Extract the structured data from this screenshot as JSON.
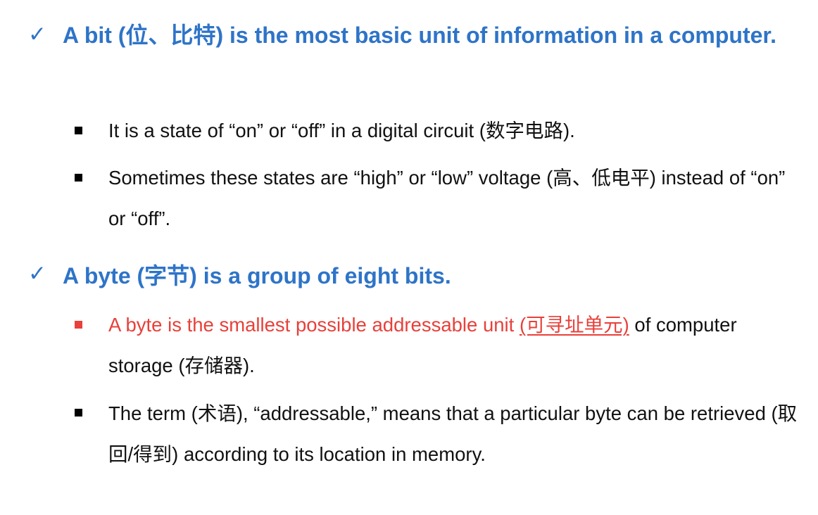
{
  "bullets": [
    {
      "heading": "A bit (位、比特) is the most basic unit of information in a computer.",
      "sub": [
        "It is a state of “on” or “off” in a digital circuit (数字电路).",
        "Sometimes these states are “high” or “low” voltage (高、低电平) instead of “on” or “off”."
      ]
    },
    {
      "heading": "A byte (字节) is a group of eight bits.",
      "sub": [
        {
          "red": "A byte is the smallest possible addressable unit ",
          "red_underlined": "(可寻址单元)",
          "rest": " of computer storage (存储器)."
        },
        "The term (术语), “addressable,” means that a particular byte can be retrieved (取回/得到) according to its location in memory."
      ]
    }
  ],
  "icons": {
    "check": "✓",
    "square": "square-bullet-icon"
  },
  "colors": {
    "heading": "#2e74c8",
    "highlight": "#e8403a",
    "text": "#111111"
  }
}
